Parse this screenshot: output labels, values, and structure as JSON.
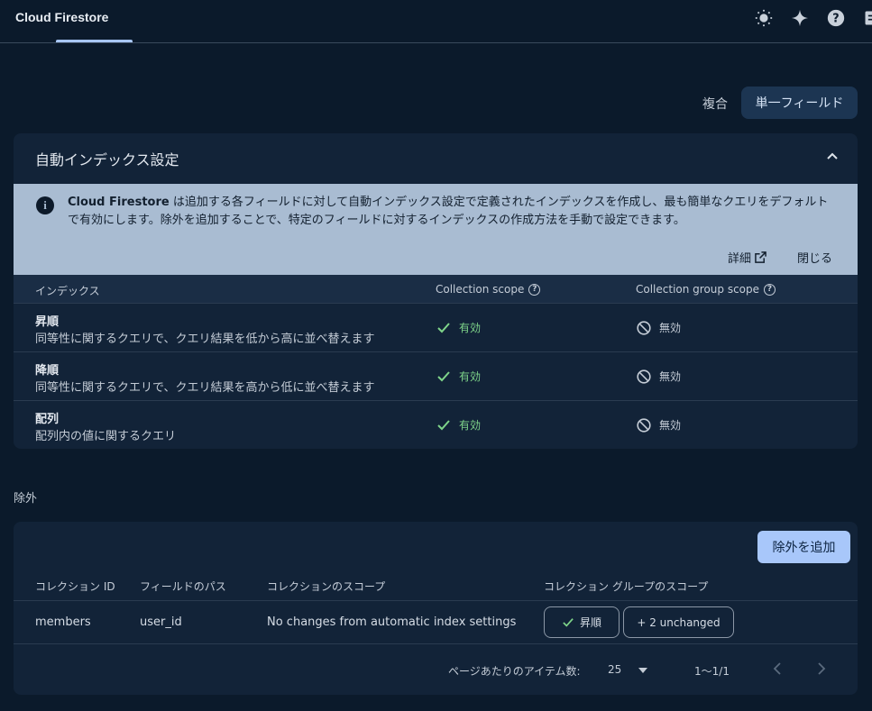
{
  "app": {
    "title": "Cloud Firestore"
  },
  "header_icons": [
    "brightness-icon",
    "sparkle-icon",
    "help-icon",
    "panel-icon"
  ],
  "toggle": {
    "composite": "複合",
    "single_field": "単一フィールド"
  },
  "auto_index": {
    "title": "自動インデックス設定",
    "banner": {
      "brand": "Cloud Firestore",
      "text": " は追加する各フィールドに対して自動インデックス設定で定義されたインデックスを作成し、最も簡単なクエリをデフォルトで有効にします。除外を追加することで、特定のフィールドに対するインデックスの作成方法を手動で設定できます。",
      "detail": "詳細",
      "close": "閉じる"
    },
    "columns": {
      "index": "インデックス",
      "collection_scope": "Collection scope",
      "group_scope": "Collection group scope"
    },
    "rows": [
      {
        "name": "昇順",
        "desc": "同等性に関するクエリで、クエリ結果を低から高に並べ替えます",
        "collection": "有効",
        "group": "無効"
      },
      {
        "name": "降順",
        "desc": "同等性に関するクエリで、クエリ結果を高から低に並べ替えます",
        "collection": "有効",
        "group": "無効"
      },
      {
        "name": "配列",
        "desc": "配列内の値に関するクエリ",
        "collection": "有効",
        "group": "無効"
      }
    ]
  },
  "exemptions": {
    "label": "除外",
    "add_button": "除外を追加",
    "columns": {
      "collection_id": "コレクション ID",
      "field_path": "フィールドのパス",
      "collection_scope": "コレクションのスコープ",
      "group_scope": "コレクション グループのスコープ"
    },
    "row": {
      "collection_id": "members",
      "field_path": "user_id",
      "collection_scope": "No changes from automatic index settings",
      "chip_ascending": "昇順",
      "chip_unchanged": "+ 2 unchanged"
    },
    "pager": {
      "label": "ページあたりのアイテム数:",
      "per_page": "25",
      "range": "1〜1/1"
    }
  },
  "colors": {
    "background": "#0b1a2b",
    "card": "#122338",
    "accent": "#a8c7fa",
    "enabled": "#7fd58a",
    "banner": "#a9bcd2"
  }
}
